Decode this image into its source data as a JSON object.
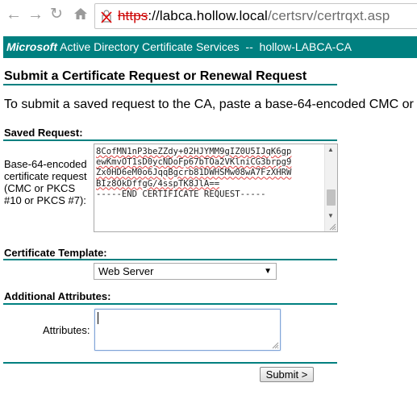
{
  "browser": {
    "url_scheme": "https",
    "url_host": "://labca.hollow.local",
    "url_path": "/certsrv/certrqxt.asp",
    "icons": [
      "back-icon",
      "forward-icon",
      "reload-icon",
      "home-icon",
      "broken-lock-icon"
    ]
  },
  "banner": {
    "brand": "Microsoft",
    "service": "Active Directory Certificate Services",
    "separator": "--",
    "ca_name": "hollow-LABCA-CA"
  },
  "page": {
    "title": "Submit a Certificate Request or Renewal Request",
    "instructions": "To submit a saved request to the CA, paste a base-64-encoded CMC or"
  },
  "saved_request": {
    "section_title": "Saved Request:",
    "field_label": "Base-64-encoded certificate request (CMC or PKCS #10 or PKCS #7):",
    "lines": [
      "8CofMN1nP3beZZdy+02HJYMM9gIZ0U5IJqK6gp",
      "ewKmvOT1sD0ycNDoFp67bTOa2VKlniCG3brpg9",
      "Zx0HD6eM0o6JqqBgcrb81DWHSMw08wA7FzXHRW",
      "BIz8OkDffgG/4sspTK8JlA==",
      "-----END CERTIFICATE REQUEST-----"
    ]
  },
  "template": {
    "section_title": "Certificate Template:",
    "selected": "Web Server",
    "arrow": "▼"
  },
  "attributes": {
    "section_title": "Additional Attributes:",
    "label": "Attributes:",
    "value": ""
  },
  "submit": {
    "label": "Submit >"
  },
  "colors": {
    "teal": "#008080",
    "insecure_red": "#cc0000"
  }
}
